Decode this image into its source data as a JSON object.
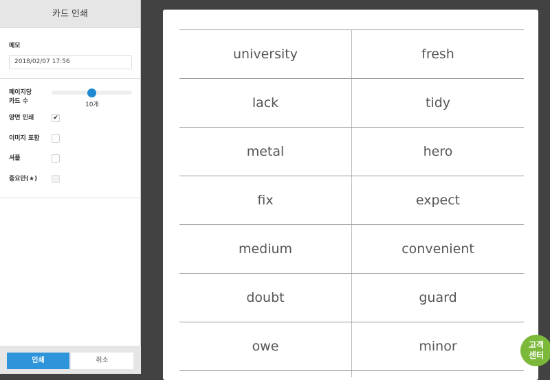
{
  "sidebar": {
    "title": "카드 인쇄",
    "memo_label": "메모",
    "memo_value": "2018/02/07 17:56",
    "cards_per_page_label_1": "페이지당",
    "cards_per_page_label_2": "카드 수",
    "cards_per_page_value": "10개",
    "options": [
      {
        "label": "양면 인쇄",
        "checked": true,
        "disabled": false
      },
      {
        "label": "이미지 포함",
        "checked": false,
        "disabled": false
      },
      {
        "label": "셔플",
        "checked": false,
        "disabled": false
      },
      {
        "label": "중요만(★)",
        "checked": false,
        "disabled": true
      }
    ],
    "print_label": "인쇄",
    "cancel_label": "취소",
    "check_mark": "✔"
  },
  "cards": [
    [
      "university",
      "fresh"
    ],
    [
      "lack",
      "tidy"
    ],
    [
      "metal",
      "hero"
    ],
    [
      "fix",
      "expect"
    ],
    [
      "medium",
      "convenient"
    ],
    [
      "doubt",
      "guard"
    ],
    [
      "owe",
      "minor"
    ]
  ],
  "help_button": {
    "line1": "고객",
    "line2": "센터"
  },
  "colors": {
    "primary": "#2f95db",
    "help": "#7cb83a",
    "background": "#424242"
  }
}
